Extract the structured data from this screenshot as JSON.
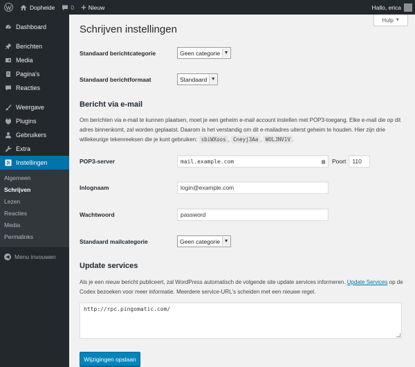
{
  "adminbar": {
    "site_name": "Dopheide",
    "comments_count": "0",
    "new_label": "Nieuw",
    "greeting": "Hallo, erica"
  },
  "sidebar": {
    "items": [
      {
        "label": "Dashboard",
        "icon": "dashboard-icon"
      },
      {
        "label": "Berichten",
        "icon": "pin-icon"
      },
      {
        "label": "Media",
        "icon": "media-icon"
      },
      {
        "label": "Pagina's",
        "icon": "page-icon"
      },
      {
        "label": "Reacties",
        "icon": "comment-icon"
      },
      {
        "label": "Weergave",
        "icon": "brush-icon"
      },
      {
        "label": "Plugins",
        "icon": "plug-icon"
      },
      {
        "label": "Gebruikers",
        "icon": "users-icon"
      },
      {
        "label": "Extra",
        "icon": "wrench-icon"
      },
      {
        "label": "Instellingen",
        "icon": "settings-icon"
      }
    ],
    "submenu": [
      "Algemeen",
      "Schrijven",
      "Lezen",
      "Reacties",
      "Media",
      "Permalinks"
    ],
    "collapse_label": "Menu invouwen"
  },
  "help_tab": "Hulp",
  "page_title": "Schrijven instellingen",
  "default_category": {
    "label": "Standaard berichtcategorie",
    "value": "Geen categorie"
  },
  "default_format": {
    "label": "Standaard berichtformaat",
    "value": "Standaard"
  },
  "post_via_email": {
    "title": "Bericht via e-mail",
    "description": "Om berichten via e-mail te kunnen plaatsen, moet je een geheim e-mail account instellen met POP3-toegang. Elke e-mail die op dit adres binnenkomt, zal worden geplaatst. Daarom is het verstandig om dit e-mailadres uiterst geheim te houden. Hier zijn drie willekeurige tekenreeksen die je kunt gebruiken:",
    "codes": [
      "sbiWXoos",
      "Cneyj3Aa",
      "WOLJNV1V"
    ],
    "pop3_label": "POP3-server",
    "pop3_value": "mail.example.com",
    "port_label": "Poort",
    "port_value": "110",
    "login_label": "Inlognaam",
    "login_value": "login@example.com",
    "password_label": "Wachtwoord",
    "password_value": "password",
    "mail_category_label": "Standaard mailcategorie",
    "mail_category_value": "Geen categorie"
  },
  "update_services": {
    "title": "Update services",
    "text_before": "Als je een nieuw bericht publiceert, zal WordPress automatisch de volgende site update services informeren.",
    "link": "Update Services",
    "text_after": "op de Codex bezoeken voor meer informatie. Meerdere service-URL's scheiden met een nieuwe regel.",
    "ping_sites": "http://rpc.pingomatic.com/"
  },
  "save_label": "Wijzigingen opslaan"
}
